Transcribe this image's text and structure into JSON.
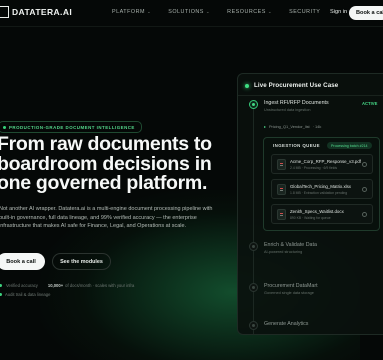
{
  "nav": {
    "logo_text": "DATATERA.AI",
    "links": [
      {
        "label": "PLATFORM",
        "has_menu": true
      },
      {
        "label": "SOLUTIONS",
        "has_menu": true
      },
      {
        "label": "RESOURCES",
        "has_menu": true
      },
      {
        "label": "SECURITY",
        "has_menu": false
      }
    ],
    "sign_in": "Sign in",
    "cta": "Book a call"
  },
  "hero": {
    "pill": "PRODUCTION-GRADE DOCUMENT INTELLIGENCE",
    "headline": [
      "From raw documents to",
      "boardroom decisions in",
      "one governed platform."
    ],
    "description": "Not another AI wrapper. Datatera.ai is a multi-engine document processing pipeline with built-in governance, full data lineage, and 99% verified accuracy — the enterprise infrastructure that makes AI safe for Finance, Legal, and Operations at scale.",
    "primary_button": "Book a call",
    "secondary_button": "See the modules",
    "stats": [
      {
        "value": "",
        "label": "Verified accuracy"
      },
      {
        "value": "10,000+",
        "label": "of docs/month · scales with your infra"
      }
    ],
    "stats_line2": "Audit trail & data lineage"
  },
  "panel": {
    "title": "Live Procurement Use Case",
    "steps": [
      {
        "title": "Ingest RFI/RFP Documents",
        "sub": "Unstructured data ingestion",
        "status": "ACTIVE"
      },
      {
        "title": "Enrich & Validate Data",
        "sub": "AI-powered structuring"
      },
      {
        "title": "Procurement DataMart",
        "sub": "Governed single data storage"
      },
      {
        "title": "Generate Analytics",
        "sub": ""
      }
    ],
    "chip": {
      "label": "Pricing_Q1_Vendor_list",
      "extra": "· 14k"
    },
    "guide": {
      "title": "INGESTION QUEUE",
      "badge": "Processing batch #214",
      "docs": [
        {
          "name": "Acme_Corp_RFP_Response_v3.pdf",
          "meta": "2.4 MB · Processing · 6/9 fields"
        },
        {
          "name": "GlobalTech_Pricing_Matrix.xlsx",
          "meta": "1.8 MB · Extraction validation pending"
        },
        {
          "name": "Zenith_Specs_Waitlist.docx",
          "meta": "890 KB · Waiting for queue"
        }
      ]
    }
  }
}
